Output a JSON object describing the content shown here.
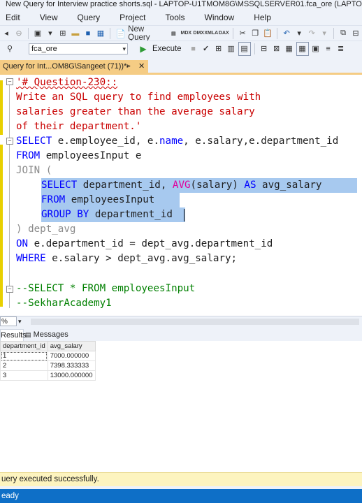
{
  "window": {
    "title": "New Query for Interview practice shorts.sql - LAPTOP-U1TMOM8G\\MSSQLSERVER01.fca_ore (LAPTOP-U1TM"
  },
  "menu": [
    "Edit",
    "View",
    "Query",
    "Project",
    "Tools",
    "Window",
    "Help"
  ],
  "toolbar": {
    "new_query_label": "New Query",
    "icon_labels": [
      "MDX",
      "DMX",
      "XMLA",
      "DAX"
    ],
    "database": "fca_ore",
    "execute_label": "Execute"
  },
  "tab": {
    "title": "Query for Int...OM8G\\Sangeet (71))*",
    "pin": "⩺",
    "close": "✕"
  },
  "editor": {
    "lines": {
      "l1": "'# Question-230::",
      "l2": "Write an SQL query to find employees with",
      "l3": "salaries greater than the average salary",
      "l4": "of their department.'",
      "l5a": "SELECT",
      "l5b": " e.employee_id, e.",
      "l5c": "name",
      "l5d": ", e.salary,e.department_id",
      "l6a": "FROM",
      "l6b": " employeesInput e",
      "l7": "JOIN (",
      "l8a": "SELECT",
      "l8b": " department_id, ",
      "l8c": "AVG",
      "l8d": "(salary) ",
      "l8e": "AS",
      "l8f": " avg_salary",
      "l9a": "FROM",
      "l9b": " employeesInput",
      "l10a": "GROUP BY",
      "l10b": " department_id ",
      "l11": ") dept_avg",
      "l12a": "ON",
      "l12b": " e.department_id = dept_avg.department_id",
      "l13a": "WHERE",
      "l13b": " e.salary > dept_avg.avg_salary;",
      "l14": "--SELECT * FROM employeesInput",
      "l15": "--SekharAcademy1"
    }
  },
  "zoom": "%",
  "results_tabs": {
    "results": "Results",
    "messages": "Messages"
  },
  "results": {
    "columns": [
      "department_id",
      "avg_salary"
    ],
    "rows": [
      [
        "1",
        "7000.000000"
      ],
      [
        "2",
        "7398.333333"
      ],
      [
        "3",
        "13000.000000"
      ]
    ]
  },
  "query_status": "uery executed successfully.",
  "app_status": "eady",
  "colors": {
    "accent": "#0e6fc7",
    "tab": "#f5cc84",
    "selection": "#a7c9ef",
    "status_bar": "#fdf4bf"
  }
}
